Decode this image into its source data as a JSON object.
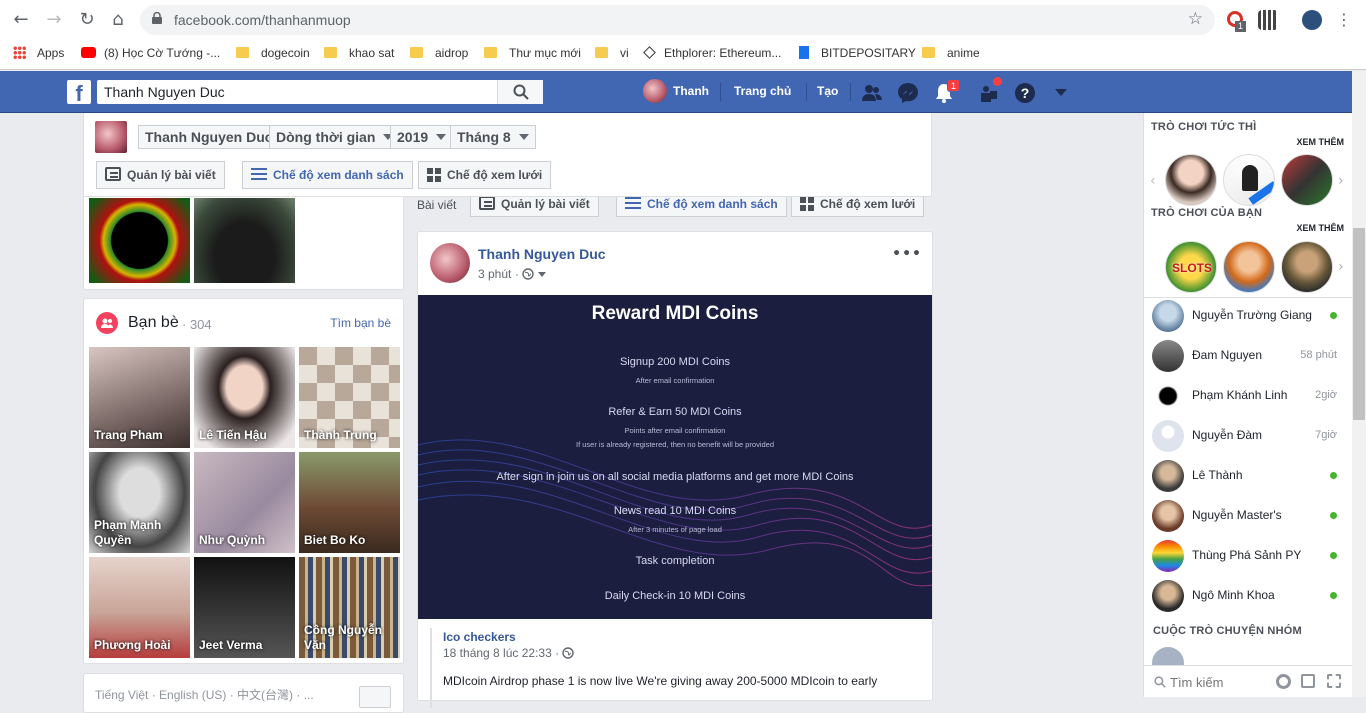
{
  "browser": {
    "url": "facebook.com/thanhanmuop",
    "bookmarks": [
      {
        "label": "Apps"
      },
      {
        "label": "(8) Học Cờ Tướng -..."
      },
      {
        "label": "dogecoin"
      },
      {
        "label": "khao sat"
      },
      {
        "label": "aidrop"
      },
      {
        "label": "Thư mục mới"
      },
      {
        "label": "vi"
      },
      {
        "label": "Ethplorer: Ethereum..."
      },
      {
        "label": "BITDEPOSITARY"
      },
      {
        "label": "anime"
      }
    ],
    "ext_badge": "1"
  },
  "fb": {
    "search_value": "Thanh Nguyen Duc",
    "user_name": "Thanh",
    "home": "Trang chủ",
    "create": "Tạo",
    "notif_count": "1",
    "colors": {
      "primary": "#4267b2",
      "online": "#42b72a",
      "badge": "#fa3e3e"
    }
  },
  "timeline_header": {
    "name": "Thanh Nguyen Duc",
    "timeline": "Dòng thời gian",
    "year": "2019",
    "month": "Tháng 8",
    "manage_posts": "Quản lý bài viết",
    "list_view": "Chế độ xem danh sách",
    "grid_view": "Chế độ xem lưới"
  },
  "posts_bar": {
    "label": "Bài viết",
    "manage_posts": "Quản lý bài viết",
    "list_view": "Chế độ xem danh sách",
    "grid_view": "Chế độ xem lưới"
  },
  "friends": {
    "title": "Bạn bè",
    "count": "· 304",
    "find": "Tìm bạn bè",
    "items": [
      {
        "name": "Trang Pham"
      },
      {
        "name": "Lê Tiến Hậu"
      },
      {
        "name": "Thành Trung"
      },
      {
        "name": "Phạm Mạnh Quyền"
      },
      {
        "name": "Như Quỳnh"
      },
      {
        "name": "Biet Bo Ko"
      },
      {
        "name": "Phương Hoài"
      },
      {
        "name": "Jeet Verma"
      },
      {
        "name": "Công Nguyễn Văn"
      }
    ]
  },
  "footer_langs": "Tiếng Việt · English (US) · 中文(台灣) · ...",
  "post": {
    "author": "Thanh Nguyen Duc",
    "time": "3 phút",
    "image": {
      "title": "Reward MDI Coins",
      "lines": [
        {
          "text": "Signup 200 MDI Coins",
          "sub": "After email confirmation"
        },
        {
          "text": "Refer & Earn 50 MDI Coins",
          "sub": "Points after email confirmation",
          "sub2": "If user is already registered, then no benefit will be provided"
        },
        {
          "text": "After sign in join us on all social media platforms and get more MDI Coins"
        },
        {
          "text": "News read 10 MDI Coins",
          "sub": "After 3 minutes of page load"
        },
        {
          "text": "Task completion"
        },
        {
          "text": "Daily Check-in 10 MDI Coins"
        }
      ]
    },
    "shared_from": "Ico checkers",
    "shared_time": "18 tháng 8 lúc 22:33 ·",
    "text": "MDIcoin Airdrop phase 1 is now live We're giving away 200-5000 MDIcoin to early"
  },
  "sidebar": {
    "instant_games": "TRÒ CHƠI TỨC THÌ",
    "your_games": "TRÒ CHƠI CỦA BẠN",
    "see_more": "XEM THÊM",
    "slots_label": "SLOTS",
    "contacts": [
      {
        "name": "Nguyễn Trường Giang",
        "status": "",
        "online": true
      },
      {
        "name": "Đam Nguyen",
        "status": "58 phút",
        "online": false
      },
      {
        "name": "Phạm Khánh Linh",
        "status": "2giờ",
        "online": false
      },
      {
        "name": "Nguyễn Đàm",
        "status": "7giờ",
        "online": false
      },
      {
        "name": "Lê Thành",
        "status": "",
        "online": true
      },
      {
        "name": "Nguyễn Master's",
        "status": "",
        "online": true
      },
      {
        "name": "Thùng Phá Sảnh PY",
        "status": "",
        "online": true
      },
      {
        "name": "Ngô Minh Khoa",
        "status": "",
        "online": true
      }
    ],
    "group_chats": "CUỘC TRÒ CHUYỆN NHÓM",
    "search_placeholder": "Tìm kiếm"
  }
}
